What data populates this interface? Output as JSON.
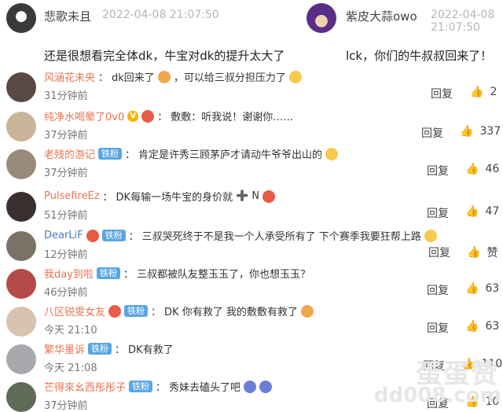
{
  "top": {
    "left": {
      "name": "悲歌未且",
      "time": "2022-04-08 21:07:50",
      "text": "还是很想看完全体dk，牛宝对dk的提升太大了"
    },
    "right": {
      "name": "紫皮大蒜owo",
      "time": "2022-04-08 21:07:50",
      "text": "lck，你们的牛叔叔回来了！"
    }
  },
  "reply_label": "回复",
  "comments": [
    {
      "user": "风涵花未央",
      "badge": "",
      "text": "dk回来了",
      "text2": "，可以给三叔分担压力了",
      "time": "31分钟前",
      "likes": "2"
    },
    {
      "user": "纯净水喝晕了0v0",
      "badge": "V",
      "text": "敷敷：听我说！谢谢你……",
      "text2": "",
      "time": "37分钟前",
      "likes": "337"
    },
    {
      "user": "老残的游记",
      "badge": "铁粉",
      "text": "肯定是许秀三顾茅庐才请动牛爷爷出山的",
      "text2": "",
      "time": "37分钟前",
      "likes": "46"
    },
    {
      "user": "PulsefireEz",
      "badge": "",
      "text": "DK每输一场牛宝的身价就",
      "text2": "N",
      "time": "51分钟前",
      "likes": "47"
    },
    {
      "user": "DearLiF",
      "badge": "铁粉",
      "text": "三叔哭死终于不是我一个人承受所有了 下个赛季我要狂帮上路",
      "text2": "",
      "time": "12分钟前",
      "likes": "赞"
    },
    {
      "user": "我day到啦",
      "badge": "铁粉",
      "text": "三叔都被队友整玉玉了，你也想玉玉？",
      "text2": "",
      "time": "46分钟前",
      "likes": "63"
    },
    {
      "user": "八区锐雯女友",
      "badge": "铁粉",
      "text": "DK 你有救了 我的敷敷有救了",
      "text2": "",
      "time": "今天 21:10",
      "likes": "63"
    },
    {
      "user": "繁华墨诉",
      "badge": "铁粉",
      "text": "DK有救了",
      "text2": "",
      "time": "今天 21:08",
      "likes": "110"
    },
    {
      "user": "芒得來幺西彤彤子",
      "badge": "铁粉",
      "text": "秀妹去磕头了吧",
      "text2": "",
      "time": "37分钟前",
      "likes": "10"
    }
  ],
  "watermark": {
    "line1": "蛋蛋赞",
    "line2": "dd008.com"
  },
  "colors": {
    "username": "#eb7350",
    "badge": "#5aa6e4",
    "time": "#777777"
  }
}
